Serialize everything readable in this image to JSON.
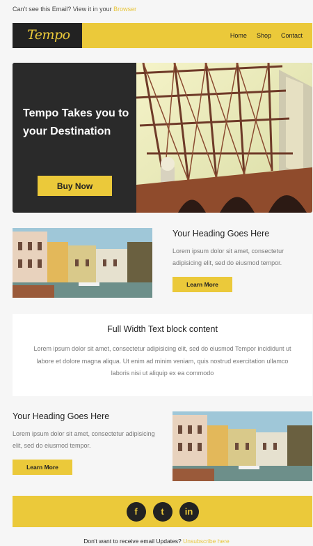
{
  "preheader": {
    "text": "Can't see this Email? View it in your",
    "link": "Browser"
  },
  "header": {
    "logo": "Tempo",
    "nav": [
      "Home",
      "Shop",
      "Contact"
    ]
  },
  "hero": {
    "title": "Tempo Takes you to your Destination",
    "button": "Buy Now"
  },
  "section1": {
    "heading": "Your Heading Goes Here",
    "text": "Lorem ipsum dolor sit amet, consectetur adipisicing elit, sed do eiusmod tempor.",
    "button": "Learn More"
  },
  "fullblock": {
    "title": "Full Width Text block content",
    "text": "Lorem ipsum dolor sit amet, consectetur adipisicing elit, sed do eiusmod Tempor incididunt ut labore et dolore magna aliqua. Ut enim ad minim veniam, quis nostrud exercitation ullamco laboris nisi ut aliquip ex ea commodo"
  },
  "section2": {
    "heading": "Your Heading Goes Here",
    "text": "Lorem ipsum dolor sit amet, consectetur adipisicing elit, sed do eiusmod tempor.",
    "button": "Learn More"
  },
  "social": [
    {
      "icon": "facebook-icon",
      "glyph": "f"
    },
    {
      "icon": "twitter-icon",
      "glyph": "t"
    },
    {
      "icon": "linkedin-icon",
      "glyph": "in"
    }
  ],
  "footer": {
    "text": "Don't want to receive email Updates?",
    "link": "Unsubscribe here"
  },
  "colors": {
    "accent": "#ebc93a",
    "dark": "#222222"
  }
}
